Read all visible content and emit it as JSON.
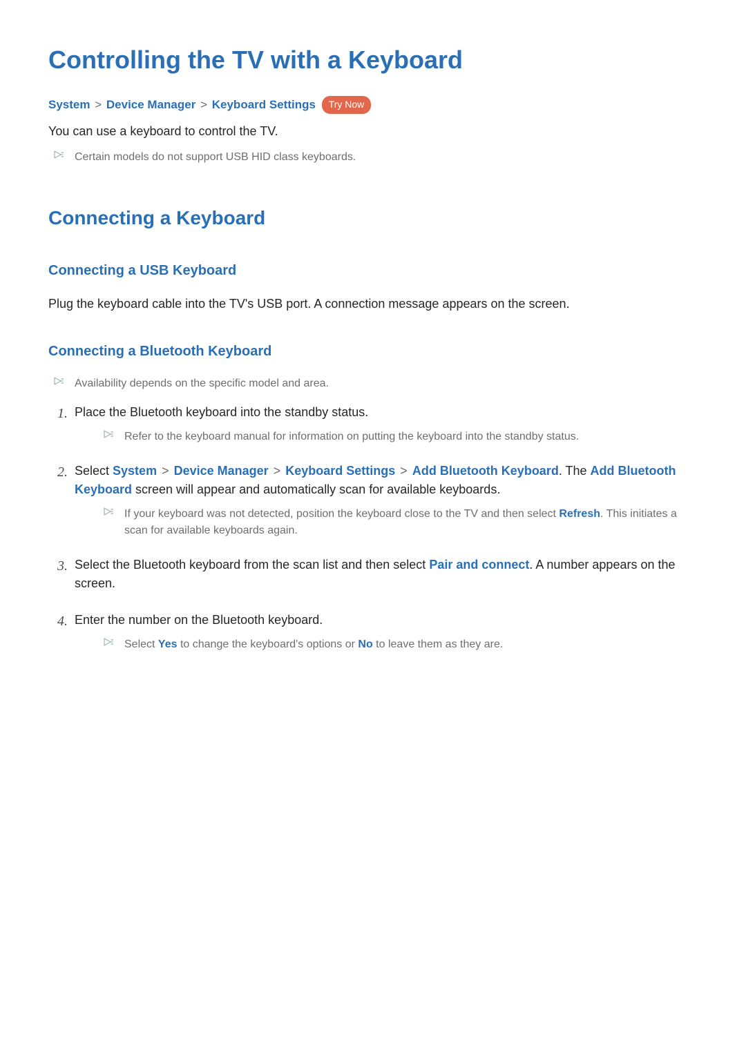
{
  "colors": {
    "accent_blue": "#2a6fb6",
    "accent_orange": "#e1664b",
    "note_grey": "#6e6e6e"
  },
  "title": "Controlling the TV with a Keyboard",
  "breadcrumb": {
    "system": "System",
    "sep": ">",
    "device_manager": "Device Manager",
    "keyboard_settings": "Keyboard Settings",
    "try_now": "Try Now"
  },
  "intro_text": "You can use a keyboard to control the TV.",
  "intro_note": "Certain models do not support USB HID class keyboards.",
  "section_connect_title": "Connecting a Keyboard",
  "usb": {
    "title": "Connecting a USB Keyboard",
    "body": "Plug the keyboard cable into the TV's USB port. A connection message appears on the screen."
  },
  "bt": {
    "title": "Connecting a Bluetooth Keyboard",
    "note_avail": "Availability depends on the specific model and area.",
    "steps": {
      "s1": {
        "num": "1.",
        "text": "Place the Bluetooth keyboard into the standby status.",
        "note": "Refer to the keyboard manual for information on putting the keyboard into the standby status."
      },
      "s2": {
        "num": "2.",
        "prefix": "Select ",
        "bc_system": "System",
        "bc_dm": "Device Manager",
        "bc_ks": "Keyboard Settings",
        "bc_add": "Add Bluetooth Keyboard",
        "mid1": ". The ",
        "add_screen": "Add Bluetooth Keyboard",
        "mid2": " screen will appear and automatically scan for available keyboards.",
        "note_before": "If your keyboard was not detected, position the keyboard close to the TV and then select ",
        "refresh": "Refresh",
        "note_after": ". This initiates a scan for available keyboards again."
      },
      "s3": {
        "num": "3.",
        "before": "Select the Bluetooth keyboard from the scan list and then select ",
        "pair": "Pair and connect",
        "after": ". A number appears on the screen."
      },
      "s4": {
        "num": "4.",
        "text": "Enter the number on the Bluetooth keyboard.",
        "note_before": "Select ",
        "yes": "Yes",
        "note_mid": " to change the keyboard's options or ",
        "no": "No",
        "note_after": " to leave them as they are."
      }
    }
  }
}
